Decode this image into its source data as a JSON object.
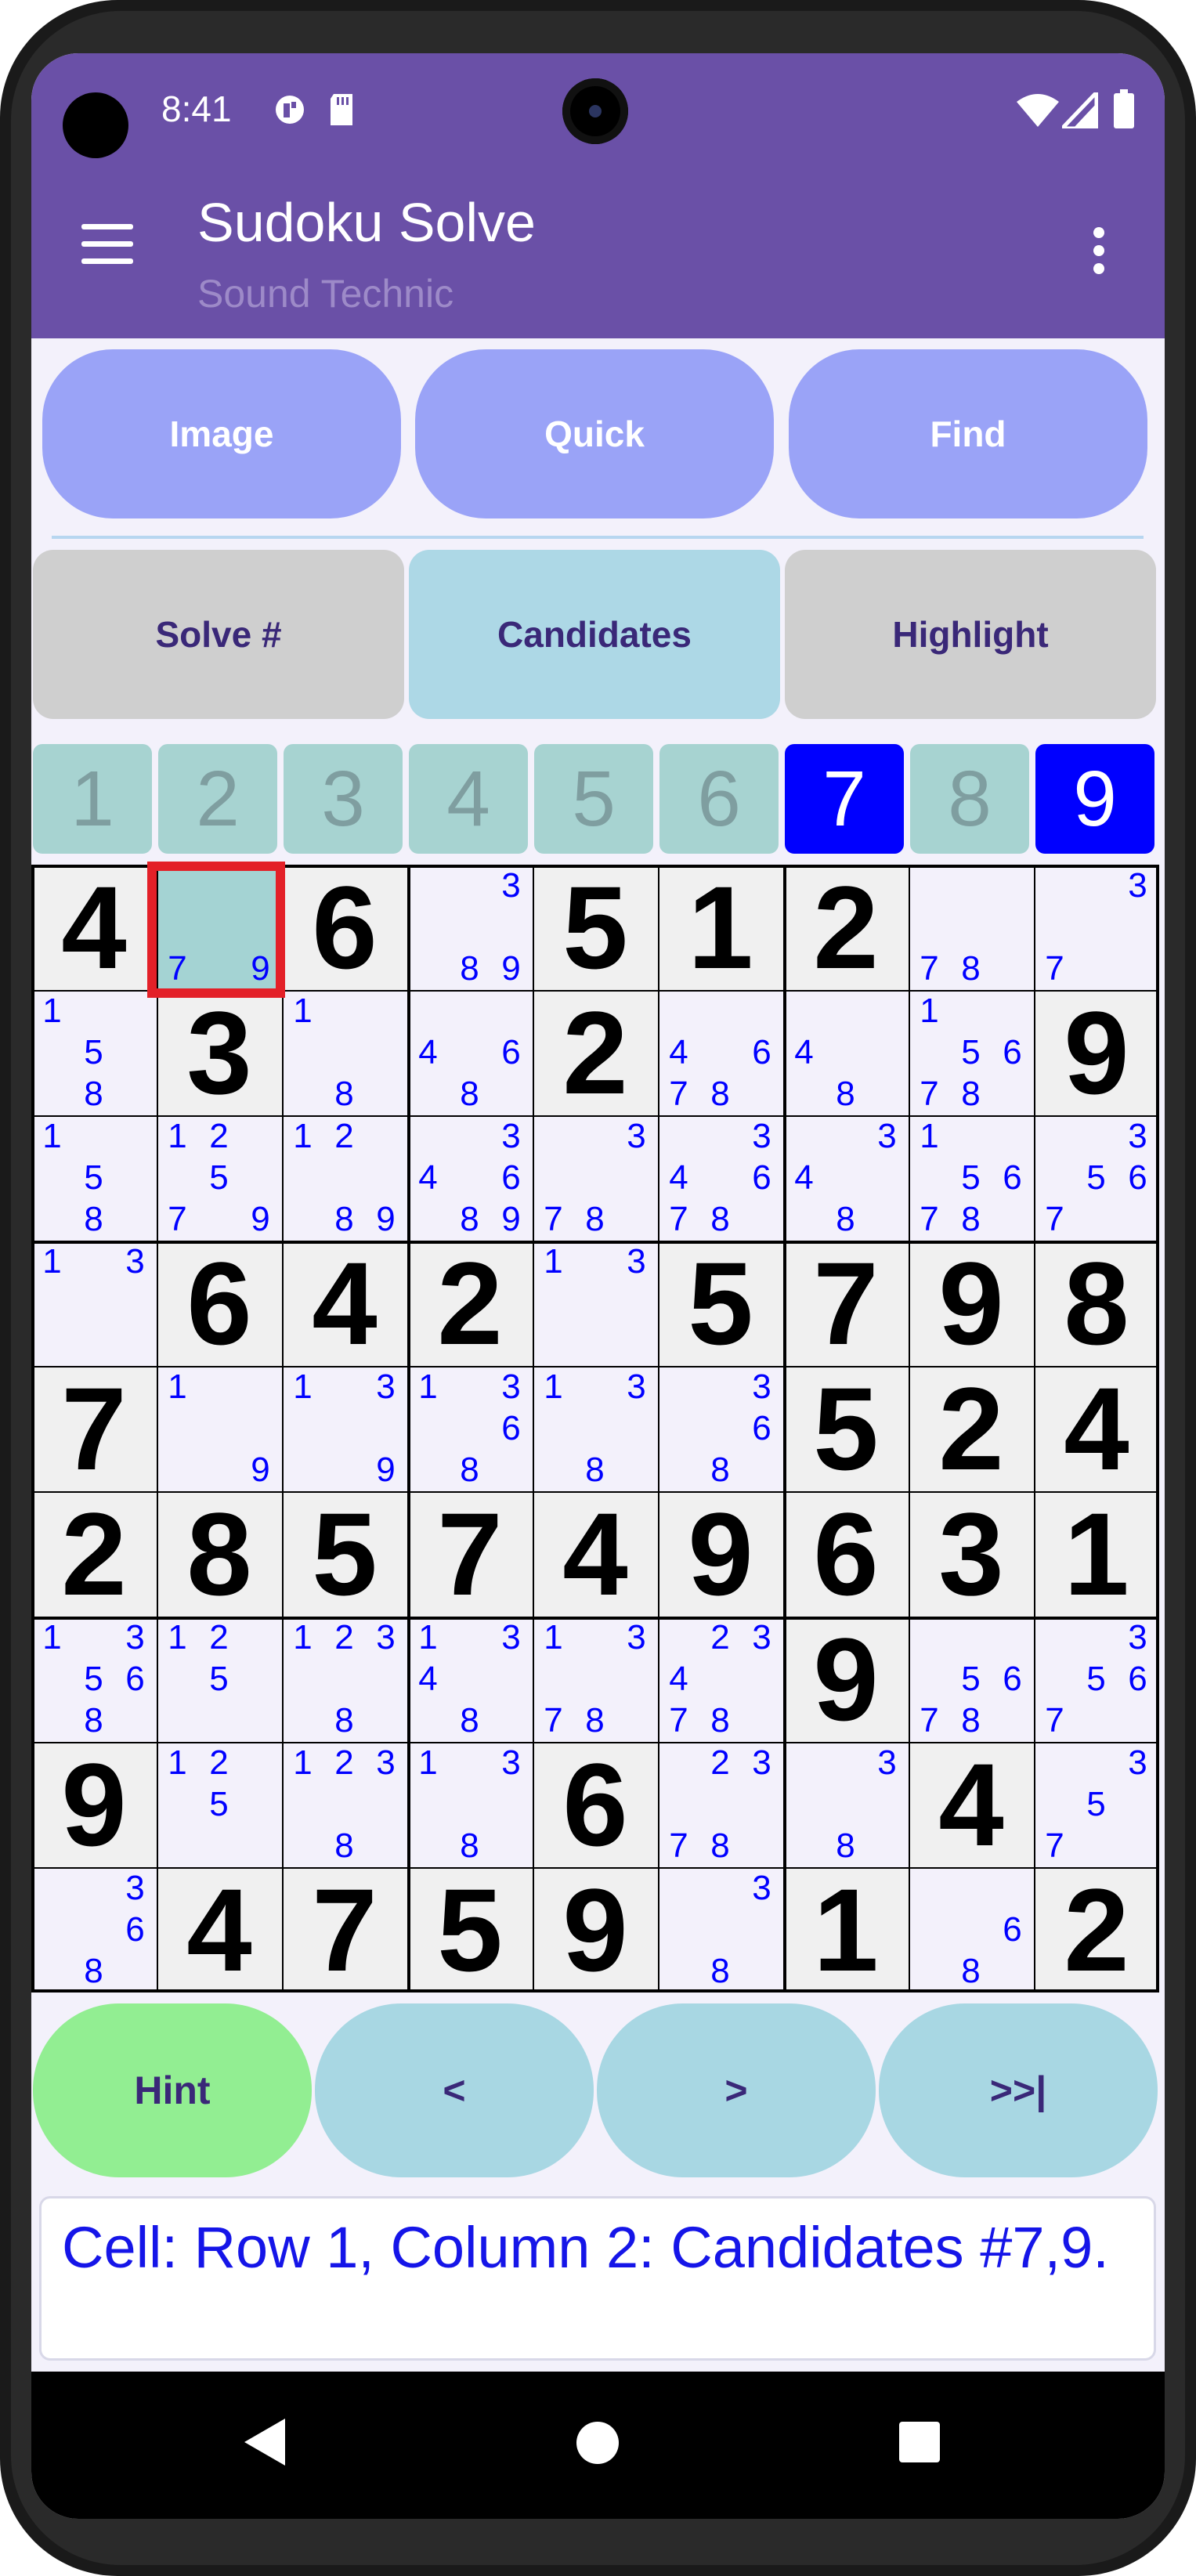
{
  "status": {
    "time": "8:41",
    "icons": [
      "notification-icon",
      "sd-card-icon",
      "wifi-icon",
      "signal-icon",
      "battery-icon"
    ]
  },
  "app": {
    "title": "Sudoku Solve",
    "subtitle": "Sound Technic"
  },
  "top_buttons": [
    "Image",
    "Quick",
    "Find"
  ],
  "mode_buttons": [
    {
      "label": "Solve #",
      "active": false
    },
    {
      "label": "Candidates",
      "active": true
    },
    {
      "label": "Highlight",
      "active": false
    }
  ],
  "digit_bar": [
    {
      "label": "1",
      "on": false
    },
    {
      "label": "2",
      "on": false
    },
    {
      "label": "3",
      "on": false
    },
    {
      "label": "4",
      "on": false
    },
    {
      "label": "5",
      "on": false
    },
    {
      "label": "6",
      "on": false
    },
    {
      "label": "7",
      "on": true
    },
    {
      "label": "8",
      "on": false
    },
    {
      "label": "9",
      "on": true
    }
  ],
  "board": {
    "selected_cell": {
      "row": 1,
      "col": 2
    },
    "cells": [
      [
        "4",
        [
          7,
          9
        ],
        "6",
        [
          3,
          8,
          9
        ],
        "5",
        "1",
        "2",
        [
          7,
          8
        ],
        [
          3,
          7
        ]
      ],
      [
        [
          1,
          5,
          8
        ],
        "3",
        [
          1,
          8
        ],
        [
          4,
          6,
          8
        ],
        "2",
        [
          4,
          6,
          7,
          8
        ],
        [
          4,
          8
        ],
        [
          1,
          5,
          6,
          7,
          8
        ],
        "9"
      ],
      [
        [
          1,
          5,
          8
        ],
        [
          1,
          2,
          5,
          7,
          9
        ],
        [
          1,
          2,
          8,
          9
        ],
        [
          3,
          4,
          6,
          8,
          9
        ],
        [
          3,
          7,
          8
        ],
        [
          3,
          4,
          6,
          7,
          8
        ],
        [
          3,
          4,
          8
        ],
        [
          1,
          5,
          6,
          7,
          8
        ],
        [
          3,
          5,
          6,
          7
        ]
      ],
      [
        [
          1,
          3
        ],
        "6",
        "4",
        "2",
        [
          1,
          3
        ],
        "5",
        "7",
        "9",
        "8"
      ],
      [
        "7",
        [
          1,
          9
        ],
        [
          1,
          3,
          9
        ],
        [
          1,
          3,
          6,
          8
        ],
        [
          1,
          3,
          8
        ],
        [
          3,
          6,
          8
        ],
        "5",
        "2",
        "4"
      ],
      [
        "2",
        "8",
        "5",
        "7",
        "4",
        "9",
        "6",
        "3",
        "1"
      ],
      [
        [
          1,
          3,
          5,
          6,
          8
        ],
        [
          1,
          2,
          5
        ],
        [
          1,
          2,
          3,
          8
        ],
        [
          1,
          3,
          4,
          8
        ],
        [
          1,
          3,
          7,
          8
        ],
        [
          2,
          3,
          4,
          7,
          8
        ],
        "9",
        [
          5,
          6,
          7,
          8
        ],
        [
          3,
          5,
          6,
          7
        ]
      ],
      [
        "9",
        [
          1,
          2,
          5
        ],
        [
          1,
          2,
          3,
          8
        ],
        [
          1,
          3,
          8
        ],
        "6",
        [
          2,
          3,
          7,
          8
        ],
        [
          3,
          8
        ],
        "4",
        [
          3,
          5,
          7
        ]
      ],
      [
        [
          3,
          6,
          8
        ],
        "4",
        "7",
        "5",
        "9",
        [
          3,
          8
        ],
        "1",
        [
          6,
          8
        ],
        "2"
      ]
    ]
  },
  "bottom_buttons": [
    {
      "label": "Hint",
      "color": "#92ee92"
    },
    {
      "label": "<",
      "color": "#a8d7e3"
    },
    {
      "label": ">",
      "color": "#a8d7e3"
    },
    {
      "label": ">>|",
      "color": "#a8d7e3"
    }
  ],
  "message": "Cell: Row 1, Column 2: Candidates #7,9.",
  "colors": {
    "appbar": "#6a50a7",
    "top_button": "#9aa3f7",
    "mode_active": "#add8e6",
    "mode_inactive": "#cfcfcf",
    "digit_on": "#0000ff",
    "candidate": "#0000ff",
    "selection": "#e32028"
  }
}
